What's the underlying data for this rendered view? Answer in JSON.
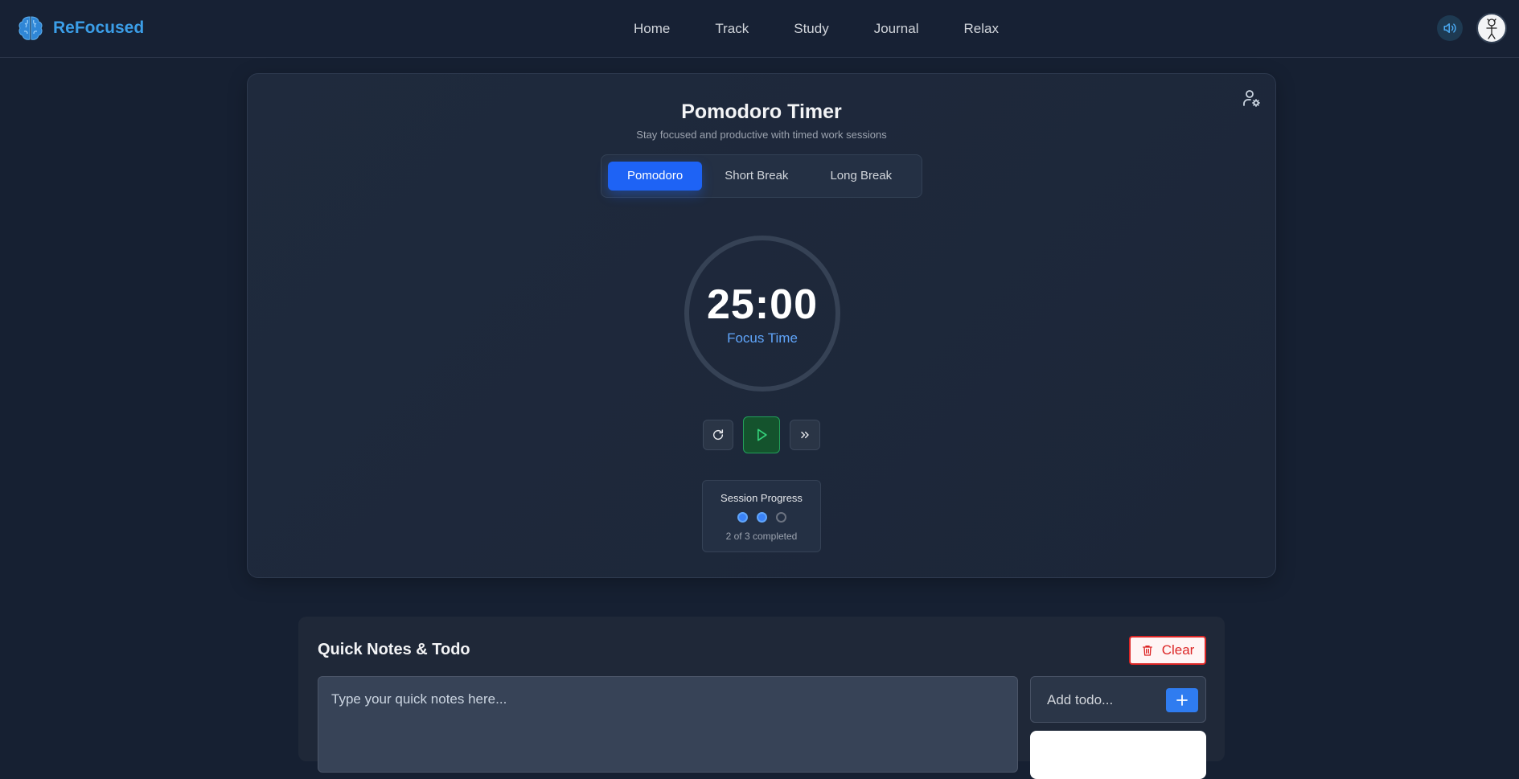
{
  "app": {
    "name": "ReFocused"
  },
  "nav": {
    "links": [
      "Home",
      "Track",
      "Study",
      "Journal",
      "Relax"
    ]
  },
  "timer": {
    "title": "Pomodoro Timer",
    "subtitle": "Stay focused and productive with timed work sessions",
    "modes": [
      "Pomodoro",
      "Short Break",
      "Long Break"
    ],
    "active_mode": "Pomodoro",
    "time": "25:00",
    "label": "Focus Time",
    "controls": {
      "reset_icon": "reset-icon",
      "play_icon": "play-icon",
      "skip_icon": "skip-icon"
    }
  },
  "session_progress": {
    "title": "Session Progress",
    "completed": 2,
    "total": 3,
    "text": "2 of 3 completed"
  },
  "notes": {
    "title": "Quick Notes & Todo",
    "clear_label": "Clear",
    "notes_placeholder": "Type your quick notes here...",
    "todo_placeholder": "Add todo..."
  },
  "colors": {
    "brand": "#3b9ee8",
    "accent": "#1e63f5",
    "focus_label": "#60a5fa",
    "play": "#22a05a",
    "danger": "#dc2626"
  }
}
